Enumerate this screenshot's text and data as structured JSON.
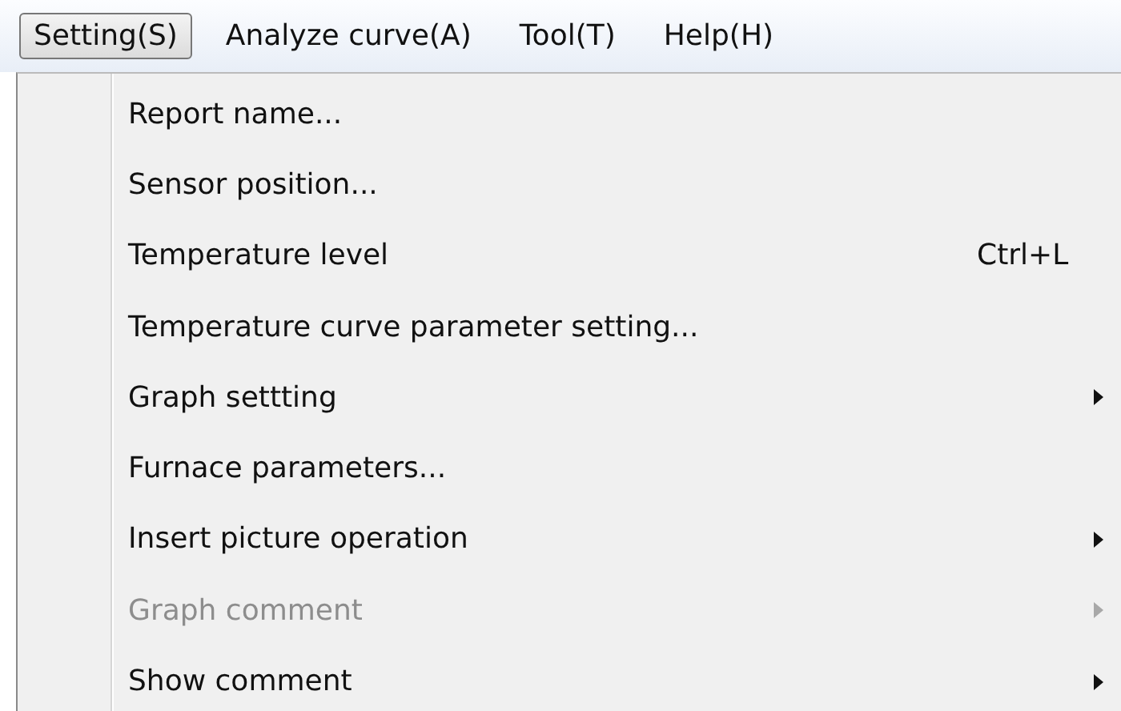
{
  "menubar": [
    {
      "label": "Setting(S)",
      "selected": true
    },
    {
      "label": "Analyze curve(A)",
      "selected": false
    },
    {
      "label": "Tool(T)",
      "selected": false
    },
    {
      "label": "Help(H)",
      "selected": false
    }
  ],
  "menu": {
    "items": [
      {
        "label": "Report name...",
        "disabled": false,
        "submenu": false
      },
      {
        "label": "Sensor position...",
        "disabled": false,
        "submenu": false
      },
      {
        "label": "Temperature level",
        "shortcut": "Ctrl+L",
        "disabled": false,
        "submenu": false
      },
      {
        "label": "Temperature curve parameter setting...",
        "disabled": false,
        "submenu": false
      },
      {
        "label": "Graph settting",
        "disabled": false,
        "submenu": true
      },
      {
        "label": "Furnace parameters...",
        "disabled": false,
        "submenu": false
      },
      {
        "label": "Insert picture operation",
        "disabled": false,
        "submenu": true
      },
      {
        "label": "Graph comment",
        "disabled": true,
        "submenu": true
      },
      {
        "label": "Show comment",
        "disabled": false,
        "submenu": true
      }
    ]
  }
}
